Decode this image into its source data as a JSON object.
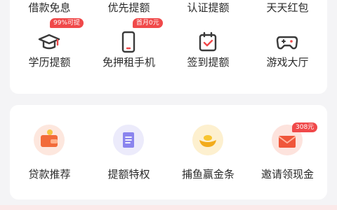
{
  "card1": {
    "top_row": [
      {
        "label": "借款免息"
      },
      {
        "label": "优先提额"
      },
      {
        "label": "认证提额"
      },
      {
        "label": "天天红包"
      }
    ],
    "icon_row": [
      {
        "label": "学历提额",
        "icon": "graduation-cap-icon",
        "badge": "99%可提"
      },
      {
        "label": "免押租手机",
        "icon": "phone-icon",
        "badge": "首月0元"
      },
      {
        "label": "签到提额",
        "icon": "calendar-check-icon"
      },
      {
        "label": "游戏大厅",
        "icon": "gamepad-icon"
      }
    ]
  },
  "card2": {
    "items": [
      {
        "label": "贷款推荐",
        "icon": "wallet-icon"
      },
      {
        "label": "提额特权",
        "icon": "document-icon"
      },
      {
        "label": "捕鱼赢金条",
        "icon": "gold-ingot-icon"
      },
      {
        "label": "邀请领现金",
        "icon": "envelope-icon",
        "badge": "308元"
      }
    ]
  },
  "colors": {
    "accent": "#f0494a",
    "page_bg": "#f4f4f6",
    "card_bg": "#ffffff"
  }
}
